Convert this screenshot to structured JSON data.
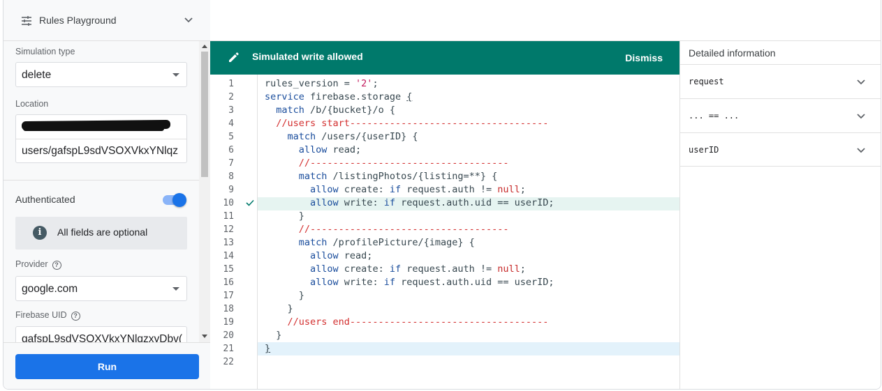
{
  "left_panel": {
    "title": "Rules Playground",
    "simulation_type_label": "Simulation type",
    "simulation_type_value": "delete",
    "location_label": "Location",
    "location_value": "users/gafspL9sdVSOXVkxYNlqz",
    "authenticated_label": "Authenticated",
    "authenticated": true,
    "info_text": "All fields are optional",
    "provider_label": "Provider",
    "provider_value": "google.com",
    "uid_label": "Firebase UID",
    "uid_value": "gafspL9sdVSOXVkxYNlqzxyDbv(",
    "run_label": "Run"
  },
  "banner": {
    "message": "Simulated write allowed",
    "dismiss_label": "Dismiss",
    "color": "#00796b"
  },
  "editor": {
    "line_numbers": [
      "1",
      "2",
      "3",
      "4",
      "5",
      "6",
      "7",
      "8",
      "9",
      "10",
      "11",
      "12",
      "13",
      "14",
      "15",
      "16",
      "17",
      "18",
      "19",
      "20",
      "21",
      "22"
    ],
    "highlighted_allow_line": 10,
    "cursor_line": 21
  },
  "detail": {
    "title": "Detailed information",
    "rows": [
      "request",
      "... == ...",
      "userID"
    ]
  },
  "colors": {
    "accent": "#1a73e8",
    "banner": "#00796b",
    "allow_highlight": "#e6f4f1",
    "cursor_highlight": "#e3f2fb"
  }
}
